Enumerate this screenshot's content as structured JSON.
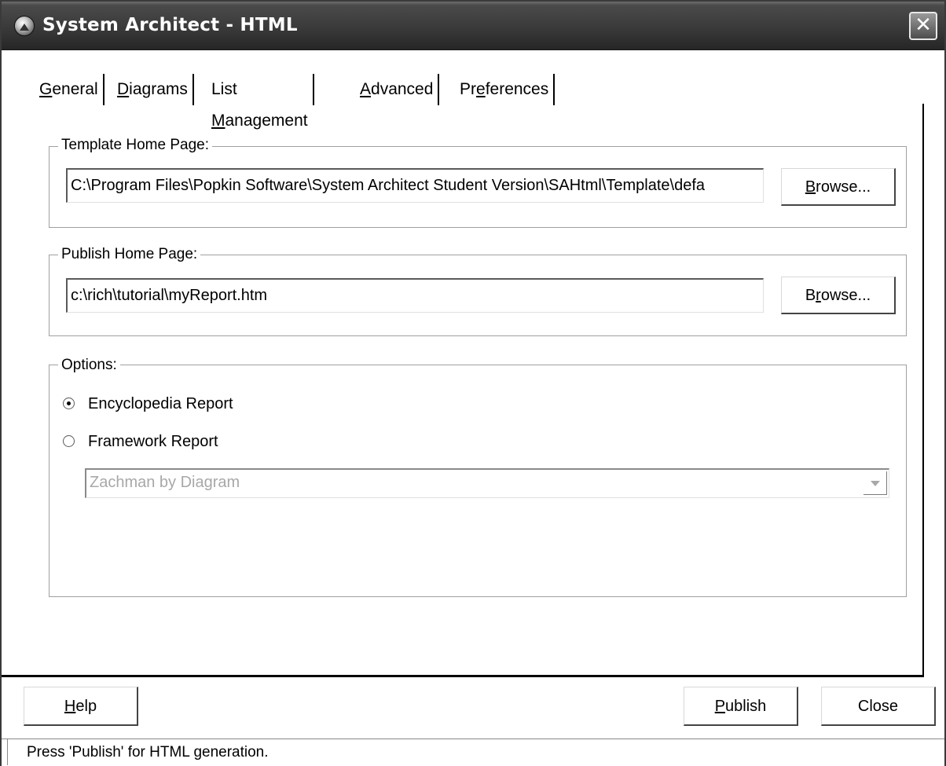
{
  "window": {
    "title": "System Architect - HTML",
    "close_glyph": "✕",
    "icon": "system-architect-app-icon"
  },
  "tabs": [
    {
      "prefix": "",
      "accel": "G",
      "suffix": "eneral",
      "selected": true
    },
    {
      "prefix": "",
      "accel": "D",
      "suffix": "iagrams",
      "selected": false
    },
    {
      "prefix": "List ",
      "accel": "M",
      "suffix": "anagement",
      "selected": false
    },
    {
      "prefix": "",
      "accel": "A",
      "suffix": "dvanced",
      "selected": false
    },
    {
      "prefix": "Pr",
      "accel": "e",
      "suffix": "ferences",
      "selected": false
    }
  ],
  "template_group": {
    "label": "Template Home Page:",
    "path": "C:\\Program Files\\Popkin Software\\System Architect Student Version\\SAHtml\\Template\\defa",
    "browse_accel": "B",
    "browse_rest": "rowse..."
  },
  "publish_group": {
    "label": "Publish Home Page:",
    "path": "c:\\rich\\tutorial\\myReport.htm",
    "browse_accel": "r",
    "browse_pre": "B",
    "browse_rest": "owse..."
  },
  "options_group": {
    "label": "Options:",
    "radio_encyclopedia": {
      "label": "Encyclopedia Report",
      "checked": true
    },
    "radio_framework": {
      "label": "Framework Report",
      "checked": false
    },
    "framework_select": {
      "value": "Zachman by Diagram",
      "disabled": true
    }
  },
  "buttons": {
    "help_accel": "H",
    "help_rest": "elp",
    "publish_accel": "P",
    "publish_rest": "ublish",
    "close_label": "Close"
  },
  "status": {
    "text": "Press 'Publish' for HTML generation."
  }
}
